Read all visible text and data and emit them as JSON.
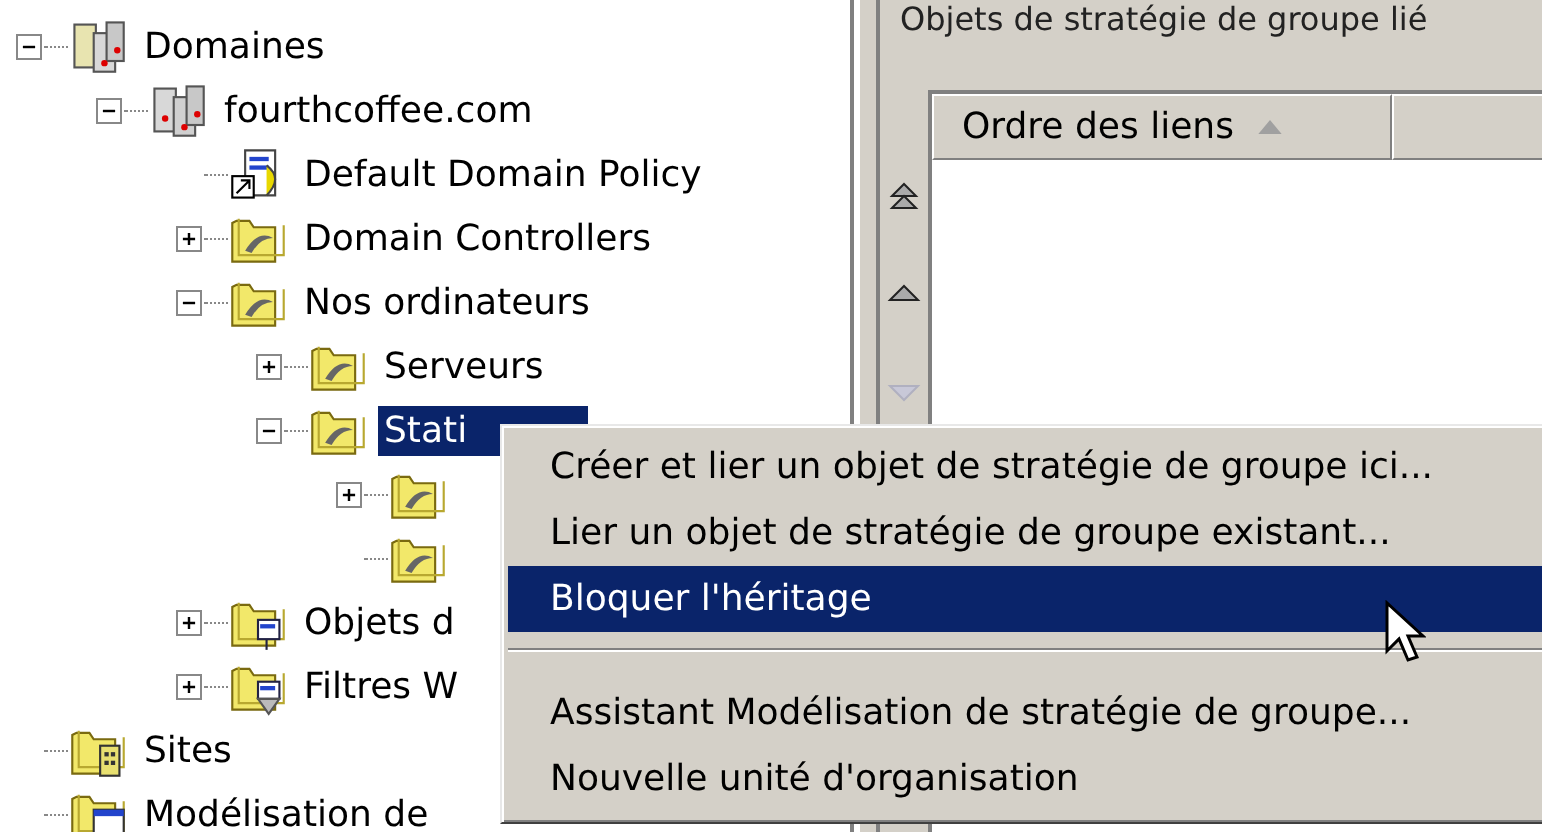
{
  "tree": [
    {
      "label": "Domaines",
      "kind": "domains",
      "expanded": true,
      "selected": false,
      "children": [
        {
          "label": "fourthcoffee.com",
          "kind": "domain",
          "expanded": true,
          "selected": false,
          "children": [
            {
              "label": "Default Domain Policy",
              "kind": "gpo-link",
              "selected": false
            },
            {
              "label": "Domain Controllers",
              "kind": "ou",
              "expanded": false,
              "selected": false
            },
            {
              "label": "Nos ordinateurs",
              "kind": "ou",
              "expanded": true,
              "selected": false,
              "children": [
                {
                  "label": "Serveurs",
                  "kind": "ou",
                  "expanded": false,
                  "selected": false
                },
                {
                  "label": "Stati",
                  "kind": "ou",
                  "expanded": true,
                  "selected": true,
                  "children": [
                    {
                      "kind": "ou",
                      "expanded": false,
                      "selected": false
                    },
                    {
                      "kind": "ou",
                      "selected": false
                    }
                  ]
                }
              ]
            },
            {
              "label": "Objets d",
              "kind": "gpo-folder",
              "expanded": false,
              "selected": false
            },
            {
              "label": "Filtres W",
              "kind": "wmi-folder",
              "expanded": false,
              "selected": false
            }
          ]
        }
      ]
    },
    {
      "label": "Sites",
      "kind": "sites",
      "selected": false
    },
    {
      "label": "Modélisation de",
      "kind": "modeling",
      "selected": false
    }
  ],
  "right_pane": {
    "title": "Objets de stratégie de groupe lié",
    "order_buttons": [
      {
        "kind": "top",
        "disabled": false
      },
      {
        "kind": "up",
        "disabled": false
      },
      {
        "kind": "down",
        "disabled": true
      }
    ],
    "list_columns": [
      {
        "label": "Ordre des liens",
        "sorted": true
      },
      {
        "sorted": false
      }
    ]
  },
  "context_menu": [
    {
      "kind": "item",
      "label": "Créer et lier un objet de stratégie de groupe ici...",
      "selected": false
    },
    {
      "kind": "item",
      "label": "Lier un objet de stratégie de groupe existant...",
      "selected": false
    },
    {
      "kind": "item",
      "label": "Bloquer l'héritage",
      "selected": true
    },
    {
      "kind": "separator"
    },
    {
      "kind": "item",
      "label": "Assistant Modélisation de stratégie de groupe...",
      "selected": false
    },
    {
      "kind": "item",
      "label": "Nouvelle unité d'organisation",
      "selected": false
    }
  ]
}
